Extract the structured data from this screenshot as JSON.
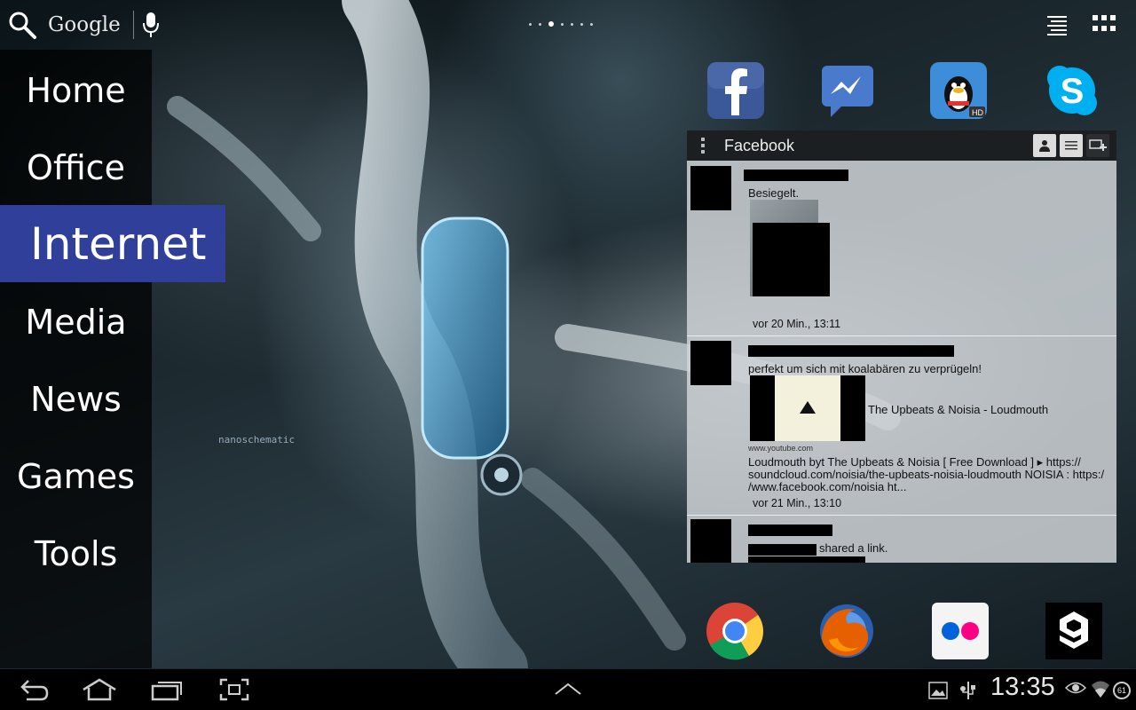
{
  "search": {
    "label": "Google"
  },
  "menu": {
    "items": [
      {
        "label": "Home"
      },
      {
        "label": "Office"
      },
      {
        "label": "Internet"
      },
      {
        "label": "Media"
      },
      {
        "label": "News"
      },
      {
        "label": "Games"
      },
      {
        "label": "Tools"
      }
    ],
    "active_index": 2
  },
  "top_icons": [
    "facebook-icon",
    "messenger-icon",
    "qq-hd-icon",
    "skype-icon"
  ],
  "dock_icons": [
    "chrome-icon",
    "firefox-icon",
    "flickr-icon",
    "9gag-icon"
  ],
  "widget": {
    "title": "Facebook",
    "posts": [
      {
        "text": "Besiegelt.",
        "time": "vor 20 Min., 13:11"
      },
      {
        "text": "perfekt um sich mit koalabären zu verprügeln!",
        "link_title": "The Upbeats & Noisia - Loudmouth",
        "link_domain": "www.youtube.com",
        "description_line1": "Loudmouth byt The Upbeats & Noisia [ Free Download ] ▸ https://",
        "description_line2": "soundcloud.com/noisia/the-upbeats-noisia-loudmouth NOISIA : https:/",
        "description_line3": "/www.facebook.com/noisia ht...",
        "time": "vor 21 Min., 13:10"
      },
      {
        "text": "shared a link."
      }
    ]
  },
  "wallpaper_label": "nanoschematic",
  "status": {
    "time": "13:35",
    "battery": "61"
  },
  "colors": {
    "menu_active": "#2f3f9a",
    "facebook_blue": "#3b5998",
    "skype_blue": "#00aff0"
  }
}
